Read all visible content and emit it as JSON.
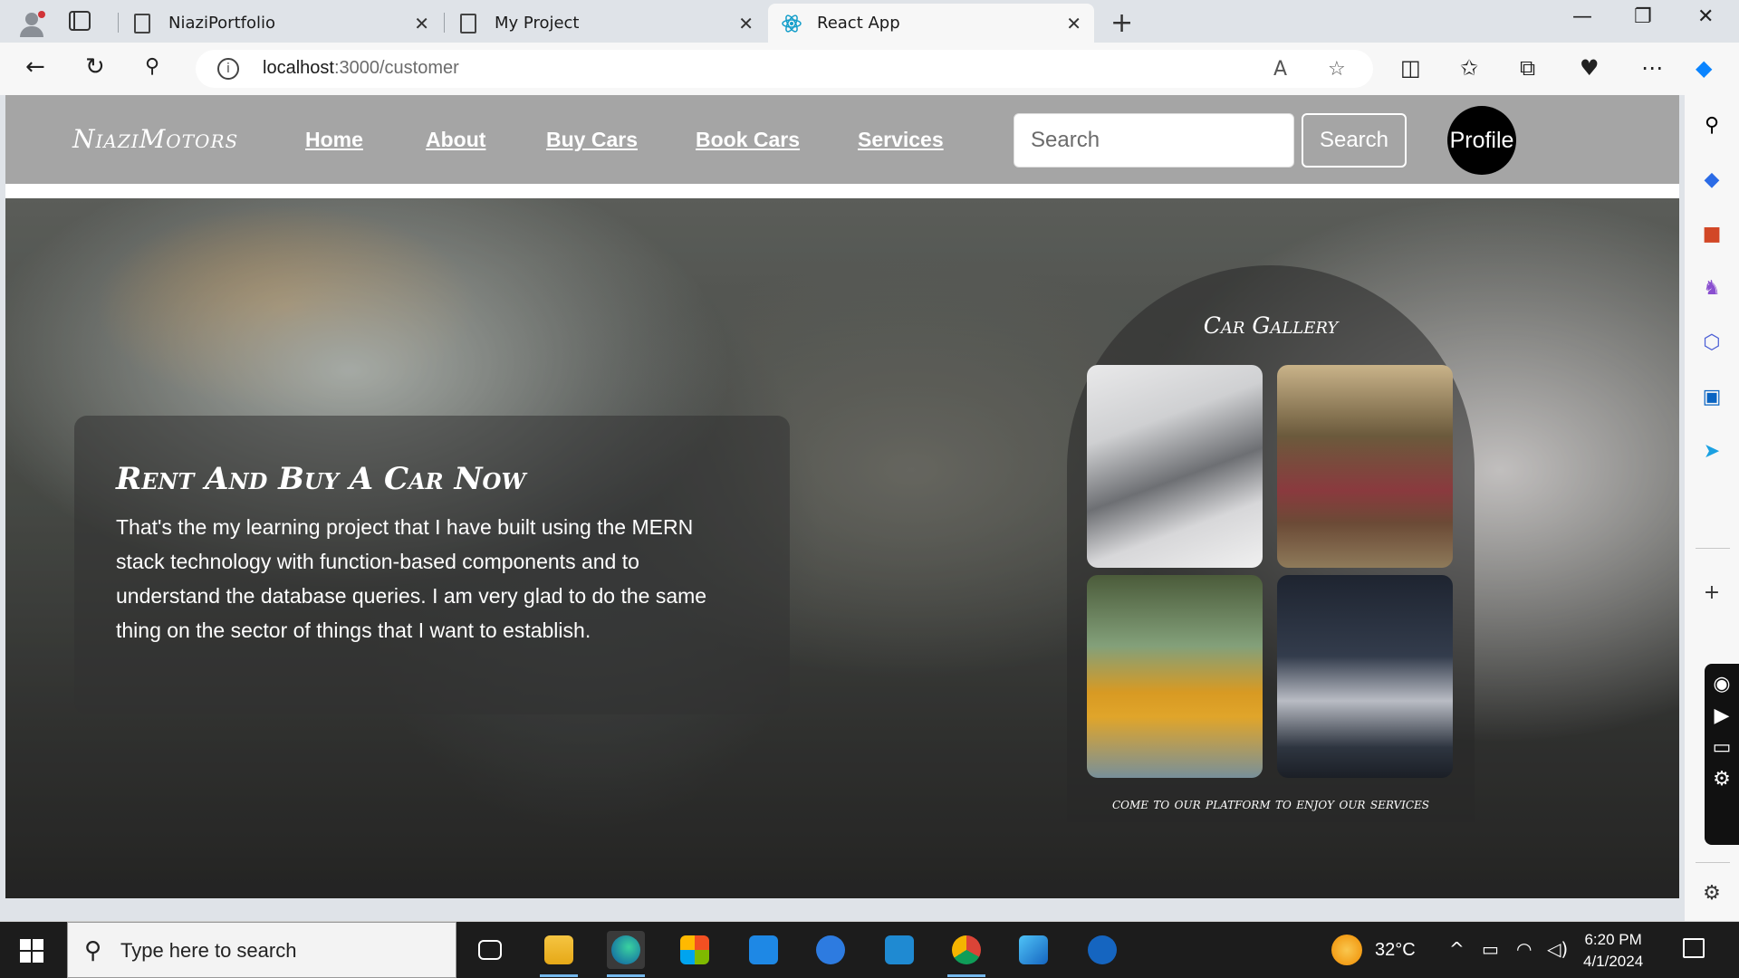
{
  "browser": {
    "tabs": [
      {
        "title": "NiaziPortfolio",
        "close": "✕"
      },
      {
        "title": "My Project",
        "close": "✕"
      },
      {
        "title": "React App",
        "close": "✕",
        "active": true
      }
    ],
    "new_tab": "+",
    "window_controls": {
      "minimize": "—",
      "restore": "❐",
      "close": "✕"
    },
    "address": {
      "host": "localhost",
      "path": ":3000/customer",
      "info": "i"
    }
  },
  "site": {
    "brand": "NiaziMotors",
    "nav": [
      "Home",
      "About",
      "Buy Cars",
      "Book Cars",
      "Services"
    ],
    "search": {
      "placeholder": "Search",
      "button": "Search"
    },
    "profile": "Profile",
    "hero": {
      "title": "Rent And Buy A Car Now",
      "text": "That's the my learning project that I have built using the MERN stack technology with function-based components and to understand the database queries. I am very glad to do the same thing on the sector of things that I want to establish."
    },
    "gallery": {
      "title": "Car Gallery",
      "caption": "come to our platform to enjoy our services"
    }
  },
  "taskbar": {
    "search_placeholder": "Type here to search",
    "temperature": "32°C",
    "time": "6:20 PM",
    "date": "4/1/2024",
    "apps": [
      "task-view",
      "file-explorer",
      "edge",
      "microsoft-store",
      "mail",
      "app-blue",
      "vs-code",
      "chrome",
      "photos",
      "app-t"
    ]
  },
  "colors": {
    "navbar_bg": "#a5a5a5",
    "taskbar_bg": "#1c1c1c",
    "profile_bg": "#000000",
    "accent": "#0078d4"
  }
}
